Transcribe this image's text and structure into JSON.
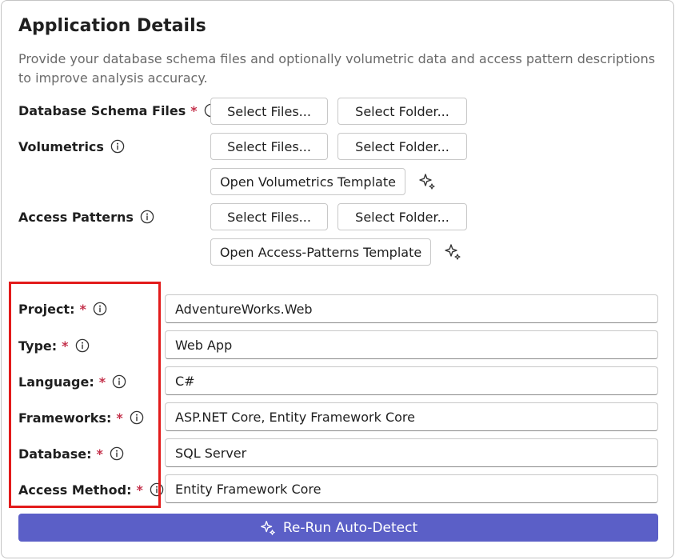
{
  "panel": {
    "title": "Application Details",
    "description": "Provide your database schema files and optionally volumetric data and access pattern descriptions to improve analysis accuracy."
  },
  "uploads": {
    "schema_label": "Database Schema Files",
    "volumetrics_label": "Volumetrics",
    "access_patterns_label": "Access Patterns",
    "select_files": "Select Files...",
    "select_folder": "Select Folder...",
    "volumetrics_template": "Open Volumetrics Template",
    "access_patterns_template": "Open Access-Patterns Template"
  },
  "required_mark": "*",
  "fields": {
    "project": {
      "label": "Project:",
      "value": "AdventureWorks.Web"
    },
    "type": {
      "label": "Type:",
      "value": "Web App"
    },
    "language": {
      "label": "Language:",
      "value": "C#"
    },
    "frameworks": {
      "label": "Frameworks:",
      "value": "ASP.NET Core, Entity Framework Core"
    },
    "database": {
      "label": "Database:",
      "value": "SQL Server"
    },
    "access_method": {
      "label": "Access Method:",
      "value": "Entity Framework Core"
    }
  },
  "actions": {
    "rerun": "Re-Run Auto-Detect"
  },
  "icons": {
    "info": "info-circle-icon",
    "sparkle": "sparkle-icon"
  },
  "colors": {
    "primary": "#5b5fc7",
    "required": "#c4314b",
    "highlight": "#e21b1b"
  }
}
